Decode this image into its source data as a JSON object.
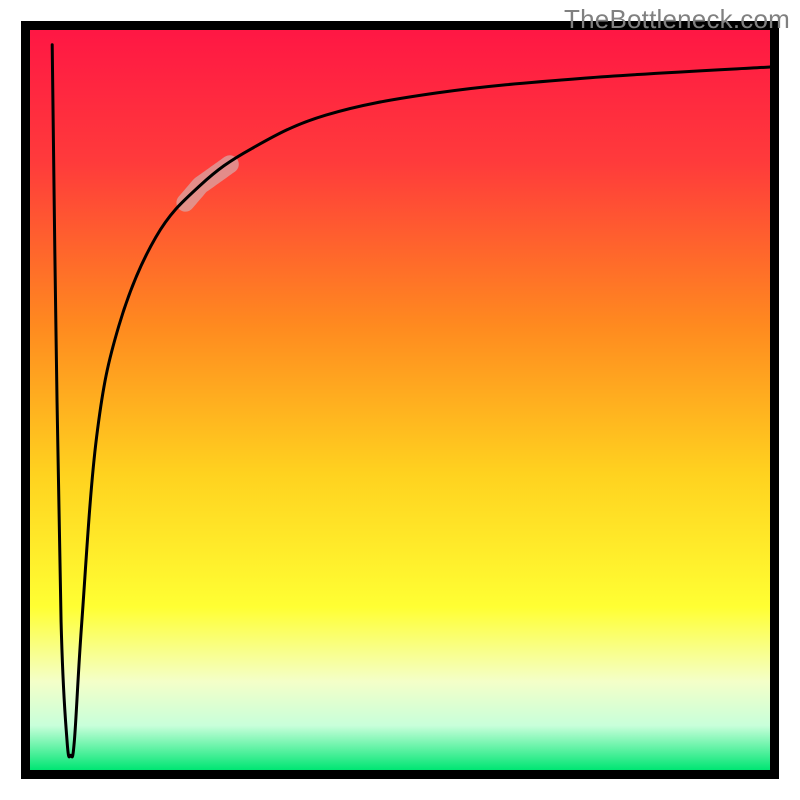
{
  "watermark": "TheBottleneck.com",
  "chart_data": {
    "type": "line",
    "title": "",
    "xlabel": "",
    "ylabel": "",
    "xlim": [
      0,
      100
    ],
    "ylim": [
      0,
      100
    ],
    "axes_visible": false,
    "grid": false,
    "background_gradient": {
      "stops": [
        {
          "offset": 0.0,
          "color": "#ff1744"
        },
        {
          "offset": 0.18,
          "color": "#ff3b3b"
        },
        {
          "offset": 0.4,
          "color": "#ff8a1f"
        },
        {
          "offset": 0.6,
          "color": "#ffd21f"
        },
        {
          "offset": 0.78,
          "color": "#ffff33"
        },
        {
          "offset": 0.88,
          "color": "#f4ffc8"
        },
        {
          "offset": 0.94,
          "color": "#c8ffda"
        },
        {
          "offset": 1.0,
          "color": "#00e673"
        }
      ]
    },
    "series": [
      {
        "name": "bottleneck-curve",
        "points": [
          {
            "x": 3.0,
            "y": 98.0
          },
          {
            "x": 3.5,
            "y": 60.0
          },
          {
            "x": 4.2,
            "y": 20.0
          },
          {
            "x": 5.0,
            "y": 4.0
          },
          {
            "x": 5.5,
            "y": 2.0
          },
          {
            "x": 6.0,
            "y": 4.0
          },
          {
            "x": 7.0,
            "y": 20.0
          },
          {
            "x": 9.0,
            "y": 45.0
          },
          {
            "x": 12.0,
            "y": 60.0
          },
          {
            "x": 17.0,
            "y": 72.0
          },
          {
            "x": 23.0,
            "y": 79.0
          },
          {
            "x": 30.0,
            "y": 84.0
          },
          {
            "x": 40.0,
            "y": 88.5
          },
          {
            "x": 55.0,
            "y": 91.5
          },
          {
            "x": 75.0,
            "y": 93.5
          },
          {
            "x": 100.0,
            "y": 95.0
          }
        ]
      }
    ],
    "highlight_segment": {
      "series": "bottleneck-curve",
      "x_start": 21,
      "x_end": 27,
      "color": "#d9a6a6",
      "opacity": 0.75
    },
    "border": {
      "color": "#000000",
      "width": 9
    }
  }
}
